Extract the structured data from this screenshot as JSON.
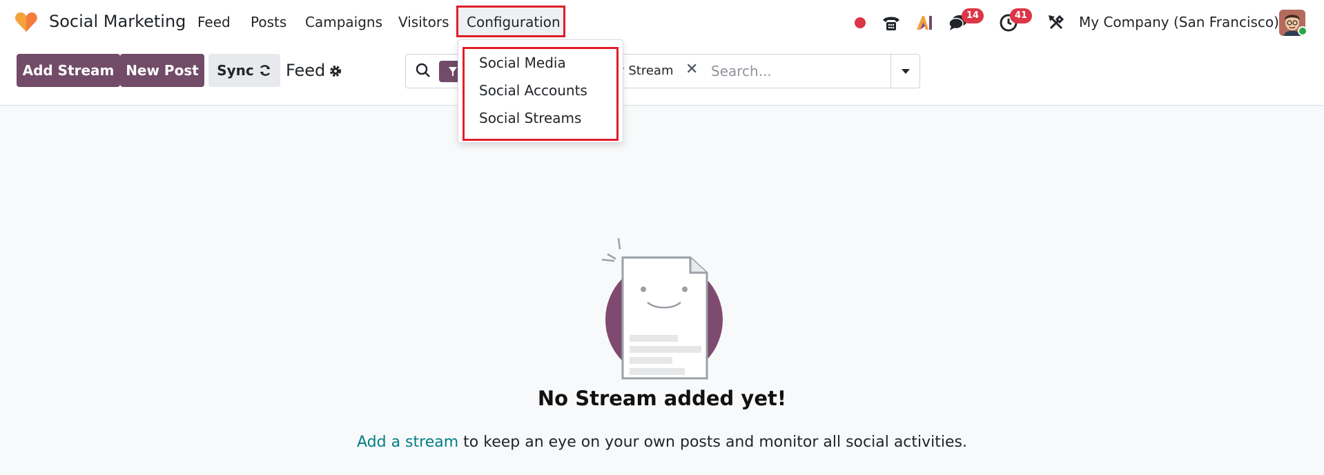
{
  "app": {
    "name": "Social Marketing"
  },
  "nav": {
    "items": [
      "Feed",
      "Posts",
      "Campaigns",
      "Visitors"
    ],
    "configuration": "Configuration",
    "dropdown_items": [
      "Social Media",
      "Social Accounts",
      "Social Streams"
    ]
  },
  "systray": {
    "messages_count": "14",
    "activities_count": "41",
    "company": "My Company (San Francisco)"
  },
  "toolbar": {
    "add_stream": "Add Stream",
    "new_post": "New Post",
    "sync": "Sync",
    "breadcrumb": "Feed"
  },
  "search": {
    "facet_text": "y Stream",
    "placeholder": "Search..."
  },
  "empty_state": {
    "title": "No Stream added yet!",
    "link": "Add a stream",
    "text": " to keep an eye on your own posts and monitor all social activities."
  },
  "colors": {
    "brand": "#714b67",
    "highlight": "#e11d2a",
    "link": "#017e84",
    "badge": "#dc3545"
  }
}
